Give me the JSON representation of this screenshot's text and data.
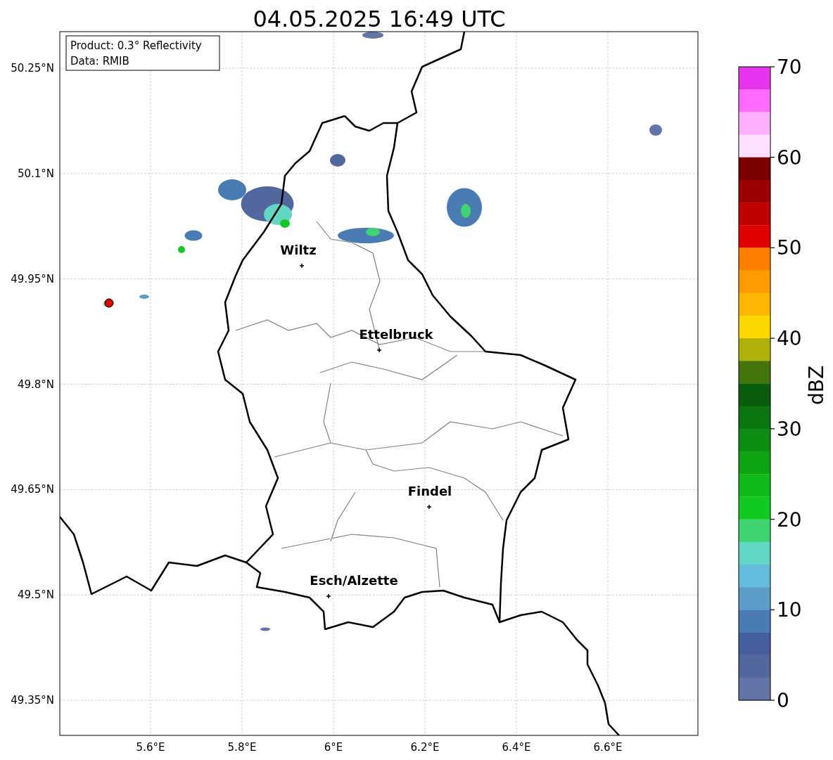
{
  "title": "04.05.2025 16:49 UTC",
  "info_box": {
    "lines": [
      "Product: 0.3° Reflectivity",
      "Data: RMIB"
    ]
  },
  "map": {
    "lat_ticks": [
      "50.25°N",
      "50.1°N",
      "49.95°N",
      "49.8°N",
      "49.65°N",
      "49.5°N",
      "49.35°N"
    ],
    "lon_ticks": [
      "5.6°E",
      "5.8°E",
      "6°E",
      "6.2°E",
      "6.4°E",
      "6.6°E"
    ],
    "cities": [
      {
        "name": "Wiltz"
      },
      {
        "name": "Ettelbruck"
      },
      {
        "name": "Findel"
      },
      {
        "name": "Esch/Alzette"
      }
    ]
  },
  "colorbar": {
    "label": "dBZ",
    "ticks": [
      "70",
      "60",
      "50",
      "40",
      "30",
      "20",
      "10",
      "0"
    ],
    "bins": [
      {
        "color": "#e834ef"
      },
      {
        "color": "#fd6afd"
      },
      {
        "color": "#feb0fe"
      },
      {
        "color": "#ffe0fe"
      },
      {
        "color": "#7a0000"
      },
      {
        "color": "#9a0000"
      },
      {
        "color": "#c00000"
      },
      {
        "color": "#e00000"
      },
      {
        "color": "#fe7e00"
      },
      {
        "color": "#fe9b00"
      },
      {
        "color": "#feb600"
      },
      {
        "color": "#fdd700"
      },
      {
        "color": "#b0b00a"
      },
      {
        "color": "#44750c"
      },
      {
        "color": "#0a5c0d"
      },
      {
        "color": "#0b7610"
      },
      {
        "color": "#0c8e12"
      },
      {
        "color": "#0ea313"
      },
      {
        "color": "#10ba1a"
      },
      {
        "color": "#12c922"
      },
      {
        "color": "#3fd470"
      },
      {
        "color": "#62d7c6"
      },
      {
        "color": "#63bcdc"
      },
      {
        "color": "#5a9dc8"
      },
      {
        "color": "#4a7bb3"
      },
      {
        "color": "#445ea0"
      },
      {
        "color": "#52679e"
      },
      {
        "color": "#6374a6"
      }
    ]
  }
}
